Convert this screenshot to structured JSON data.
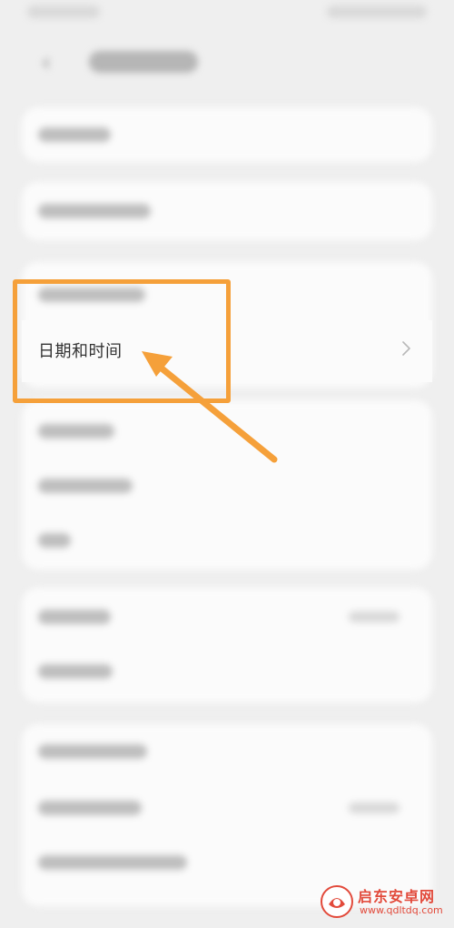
{
  "screen": {
    "focused_item": {
      "label": "日期和时间",
      "chevron_icon": "chevron-right-icon"
    }
  },
  "annotation": {
    "highlight_color": "#f5a03a",
    "arrow_color": "#f5a03a"
  },
  "watermark": {
    "name": "启东安卓网",
    "url": "www.qdltdq.com",
    "logo_color": "#e24a3b"
  }
}
